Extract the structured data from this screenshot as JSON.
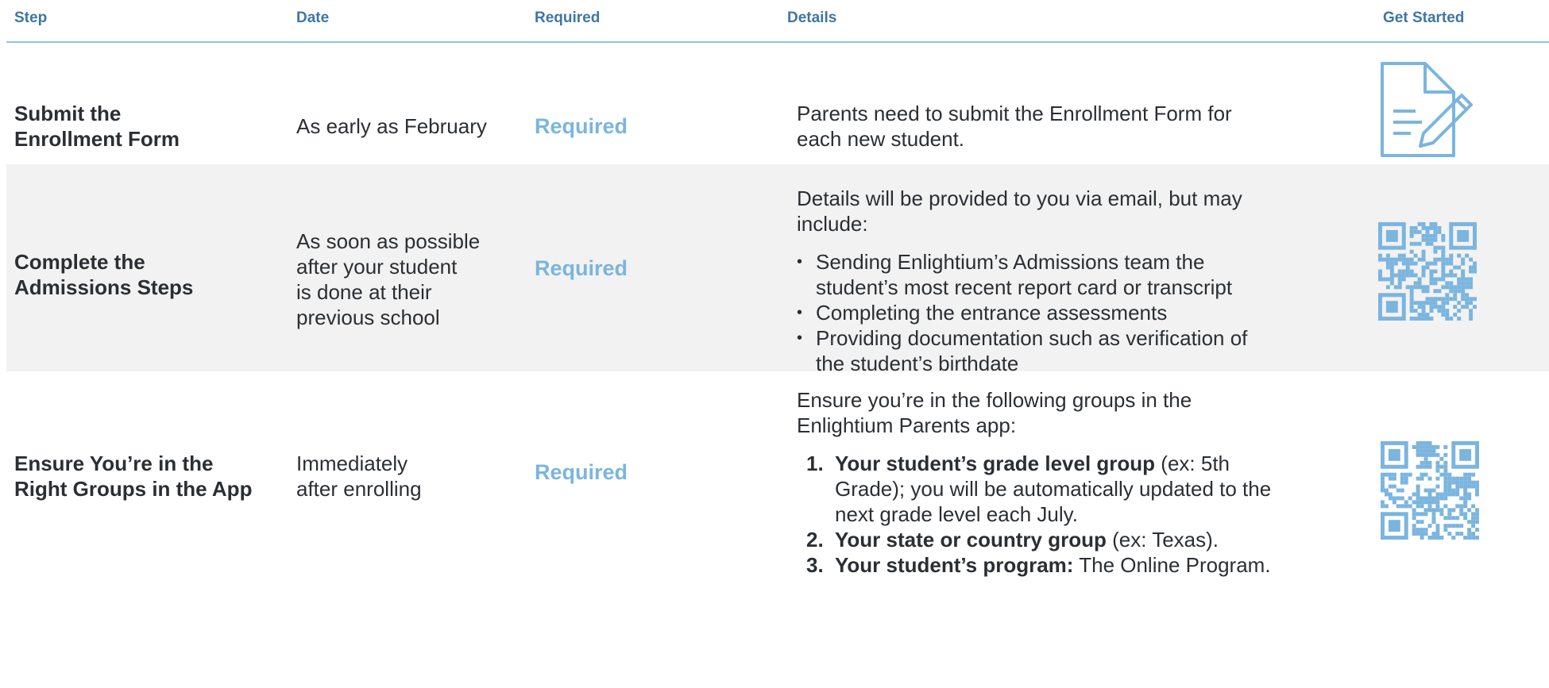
{
  "headers": {
    "step": "Step",
    "date": "Date",
    "required": "Required",
    "details": "Details",
    "get_started": "Get Started"
  },
  "rows": [
    {
      "step": [
        "Submit the",
        "Enrollment Form"
      ],
      "date": [
        "As early as February"
      ],
      "required": "Required",
      "details_intro": [
        "Parents need to submit the Enrollment Form for",
        "each new student."
      ],
      "icon": "document-pencil-icon"
    },
    {
      "step": [
        "Complete the",
        "Admissions Steps"
      ],
      "date": [
        "As soon as possible",
        "after your student",
        "is done at their",
        "previous school"
      ],
      "required": "Required",
      "details_intro": [
        "Details will be provided to you via email, but may",
        "include:"
      ],
      "bullets": [
        [
          "Sending Enlightium’s Admissions team the",
          "student’s most recent report card or transcript"
        ],
        [
          "Completing the entrance assessments"
        ],
        [
          "Providing documentation such as verification of",
          "the student’s birthdate"
        ]
      ],
      "icon": "qr-code-icon"
    },
    {
      "step": [
        "Ensure You’re in the",
        "Right Groups in the App"
      ],
      "date": [
        "Immediately",
        "after enrolling"
      ],
      "required": "Required",
      "details_intro": [
        "Ensure you’re in the following groups in the",
        "Enlightium Parents app:"
      ],
      "numbered": [
        {
          "num": "1.",
          "bold": "Your student’s grade level group",
          "rest_first": " (ex: 5th",
          "rest_lines": [
            "Grade); you will be automatically updated to the",
            "next grade level each July."
          ]
        },
        {
          "num": "2.",
          "bold": "Your state or country group",
          "rest_first": " (ex: Texas).",
          "rest_lines": []
        },
        {
          "num": "3.",
          "bold": "Your student’s program:",
          "rest_first": " The Online Program.",
          "rest_lines": []
        }
      ],
      "icon": "qr-code-icon"
    }
  ],
  "colors": {
    "header_text": "#3f76a3",
    "accent_blue": "#7bb5de",
    "row_shade": "#f2f2f2",
    "header_rule": "#8ec2e2"
  }
}
